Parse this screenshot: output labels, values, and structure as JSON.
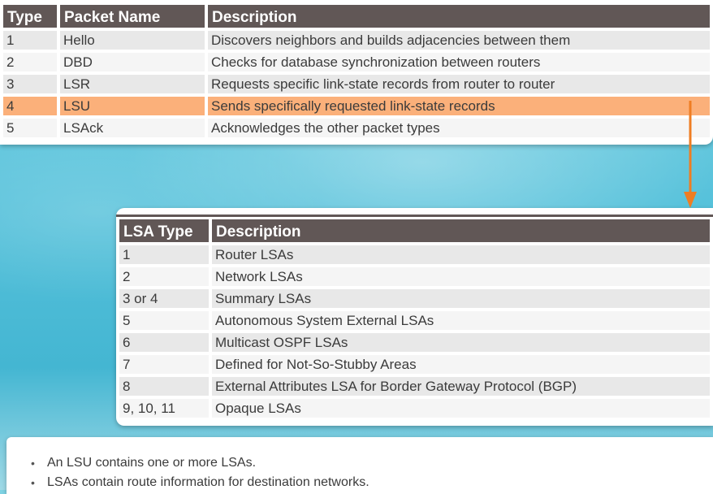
{
  "packet_table": {
    "headers": [
      "Type",
      "Packet Name",
      "Description"
    ],
    "rows": [
      {
        "type": "1",
        "name": "Hello",
        "desc": "Discovers neighbors and builds adjacencies between them"
      },
      {
        "type": "2",
        "name": "DBD",
        "desc": "Checks for database synchronization between routers"
      },
      {
        "type": "3",
        "name": "LSR",
        "desc": "Requests specific link-state records from router to router"
      },
      {
        "type": "4",
        "name": "LSU",
        "desc": "Sends specifically requested link-state records"
      },
      {
        "type": "5",
        "name": "LSAck",
        "desc": "Acknowledges the other packet types"
      }
    ],
    "highlight_color": "#fbb07a"
  },
  "lsa_table": {
    "headers": [
      "LSA Type",
      "Description"
    ],
    "rows": [
      {
        "type": "1",
        "desc": "Router LSAs"
      },
      {
        "type": "2",
        "desc": "Network LSAs"
      },
      {
        "type": "3 or 4",
        "desc": "Summary LSAs"
      },
      {
        "type": "5",
        "desc": "Autonomous System External LSAs"
      },
      {
        "type": "6",
        "desc": "Multicast OSPF LSAs"
      },
      {
        "type": "7",
        "desc": "Defined for Not-So-Stubby Areas"
      },
      {
        "type": "8",
        "desc": "External Attributes LSA for Border Gateway Protocol (BGP)"
      },
      {
        "type": "9, 10, 11",
        "desc": "Opaque LSAs"
      }
    ]
  },
  "notes": [
    "An LSU contains one or more LSAs.",
    "LSAs contain route information for destination networks."
  ],
  "colors": {
    "header_bg": "#615756",
    "arrow": "#ef7d22"
  }
}
